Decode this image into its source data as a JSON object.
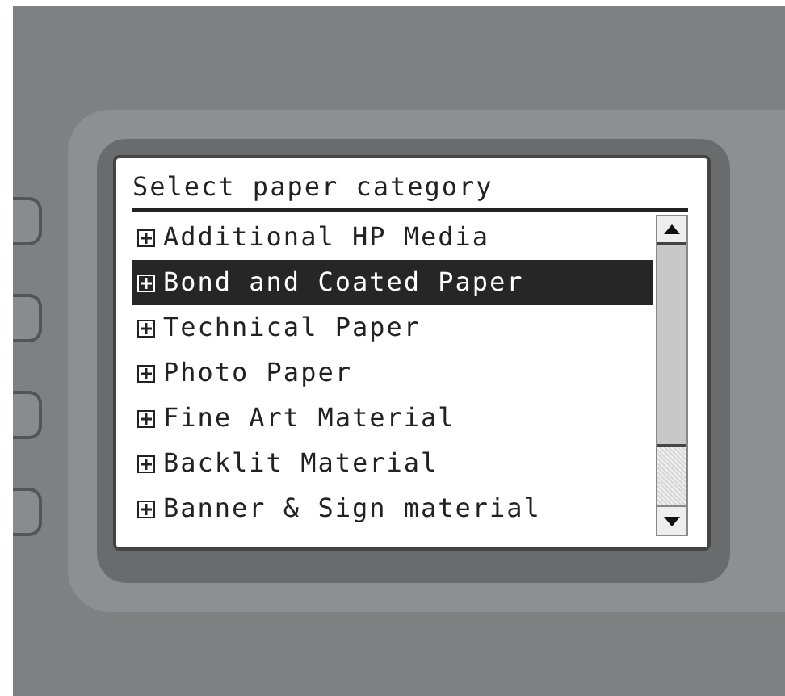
{
  "screen": {
    "title": "Select paper category",
    "items": [
      {
        "label": "Additional HP Media",
        "selected": false,
        "expanded": false
      },
      {
        "label": "Bond and Coated Paper",
        "selected": true,
        "expanded": false
      },
      {
        "label": "Technical Paper",
        "selected": false,
        "expanded": false
      },
      {
        "label": "Photo Paper",
        "selected": false,
        "expanded": false
      },
      {
        "label": "Fine Art Material",
        "selected": false,
        "expanded": false
      },
      {
        "label": "Backlit Material",
        "selected": false,
        "expanded": false
      },
      {
        "label": "Banner & Sign material",
        "selected": false,
        "expanded": false
      }
    ]
  }
}
